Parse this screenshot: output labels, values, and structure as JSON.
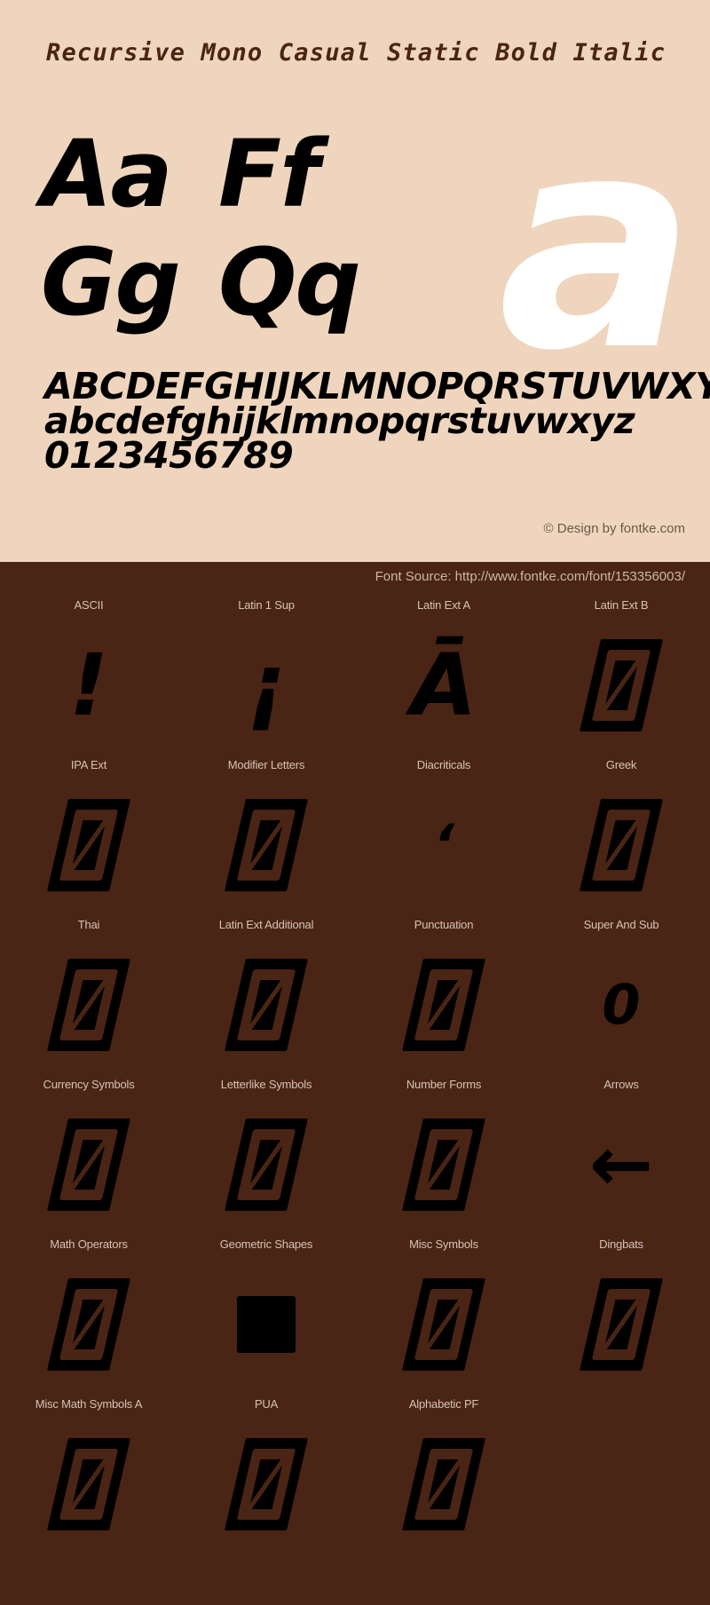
{
  "title": "Recursive Mono Casual Static Bold Italic",
  "colors": {
    "specimen_bg": "#efd5bd",
    "panel_bg": "#4a2414",
    "title_text": "#4a2414",
    "glyph_black": "#000000",
    "glyph_white": "#ffffff",
    "label_text": "#d5c3b5"
  },
  "specimen": {
    "hero_letter": "a",
    "pairs": [
      [
        "Aa",
        "Ff"
      ],
      [
        "Gg",
        "Qq"
      ]
    ],
    "alphabet_upper": "ABCDEFGHIJKLMNOPQRSTUVWXYZ",
    "alphabet_lower": "abcdefghijklmnopqrstuvwxyz",
    "digits": "0123456789",
    "credit": "© Design by fontke.com"
  },
  "source": {
    "label": "Font Source: http://www.fontke.com/font/153356003/"
  },
  "blocks": {
    "rows": [
      [
        {
          "label": "ASCII",
          "glyph": "!",
          "kind": "char"
        },
        {
          "label": "Latin 1 Sup",
          "glyph": "¡",
          "kind": "char"
        },
        {
          "label": "Latin Ext A",
          "glyph": "Ā",
          "kind": "char"
        },
        {
          "label": "Latin Ext B",
          "glyph": "",
          "kind": "tofu"
        }
      ],
      [
        {
          "label": "IPA Ext",
          "glyph": "",
          "kind": "tofu"
        },
        {
          "label": "Modifier Letters",
          "glyph": "",
          "kind": "tofu"
        },
        {
          "label": "Diacriticals",
          "glyph": "ʻ",
          "kind": "char-small"
        },
        {
          "label": "Greek",
          "glyph": "",
          "kind": "tofu"
        }
      ],
      [
        {
          "label": "Thai",
          "glyph": "",
          "kind": "tofu"
        },
        {
          "label": "Latin Ext Additional",
          "glyph": "",
          "kind": "tofu"
        },
        {
          "label": "Punctuation",
          "glyph": "",
          "kind": "tofu"
        },
        {
          "label": "Super And Sub",
          "glyph": "0",
          "kind": "char-small"
        }
      ],
      [
        {
          "label": "Currency Symbols",
          "glyph": "",
          "kind": "tofu"
        },
        {
          "label": "Letterlike Symbols",
          "glyph": "",
          "kind": "tofu"
        },
        {
          "label": "Number Forms",
          "glyph": "",
          "kind": "tofu"
        },
        {
          "label": "Arrows",
          "glyph": "←",
          "kind": "arrow"
        }
      ],
      [
        {
          "label": "Math Operators",
          "glyph": "",
          "kind": "tofu"
        },
        {
          "label": "Geometric Shapes",
          "glyph": "",
          "kind": "square"
        },
        {
          "label": "Misc Symbols",
          "glyph": "",
          "kind": "tofu"
        },
        {
          "label": "Dingbats",
          "glyph": "",
          "kind": "tofu"
        }
      ],
      [
        {
          "label": "Misc Math Symbols A",
          "glyph": "",
          "kind": "tofu"
        },
        {
          "label": "PUA",
          "glyph": "",
          "kind": "tofu"
        },
        {
          "label": "Alphabetic PF",
          "glyph": "",
          "kind": "tofu"
        },
        {
          "label": "",
          "glyph": "",
          "kind": "empty"
        }
      ]
    ]
  }
}
